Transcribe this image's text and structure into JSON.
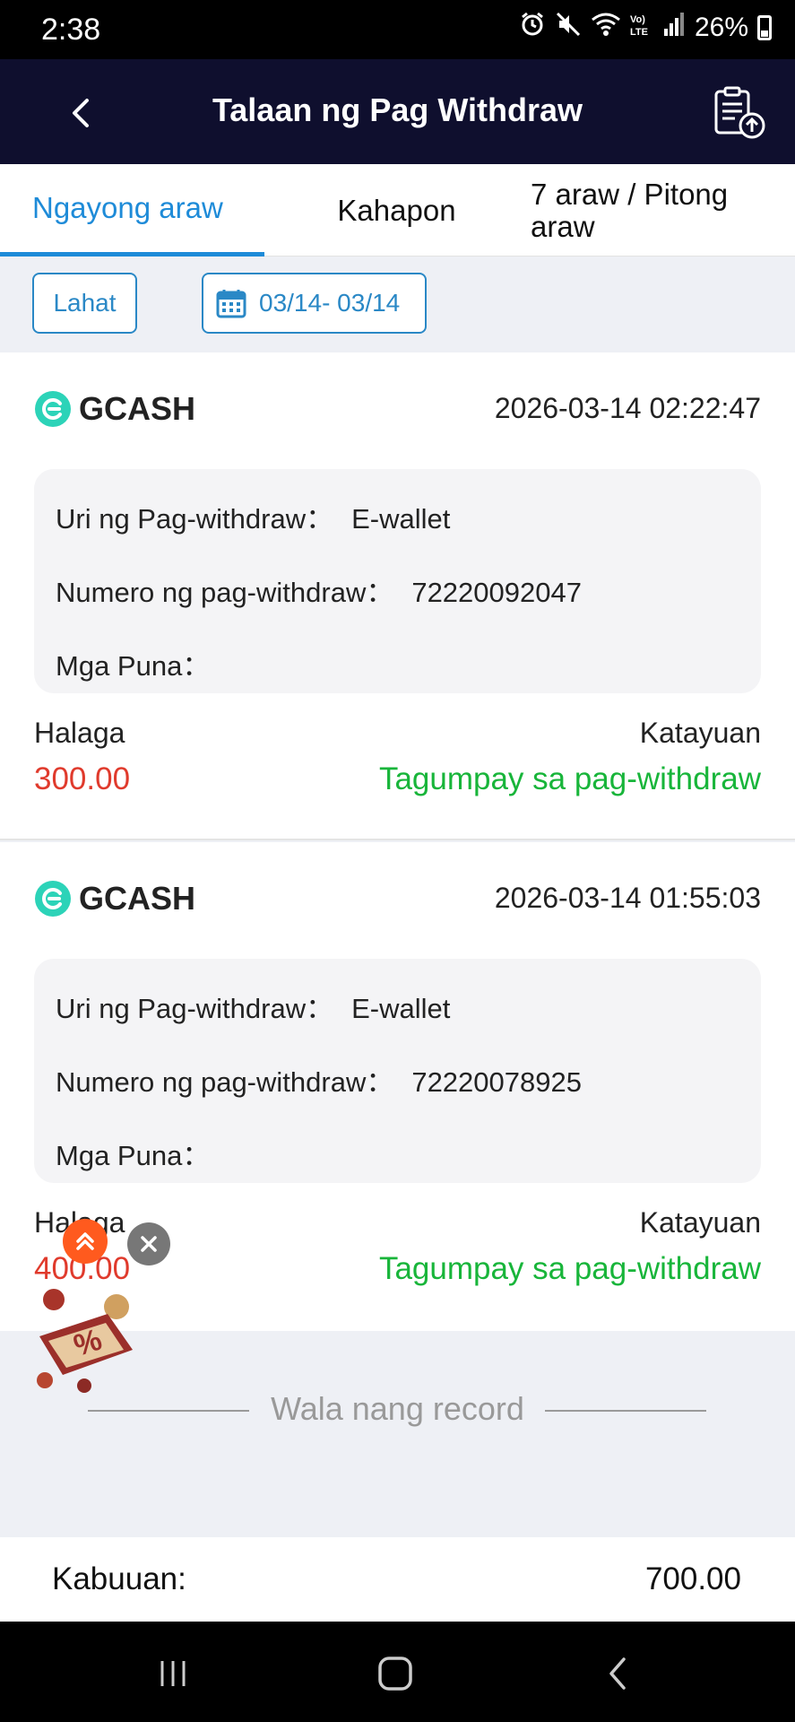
{
  "status_bar": {
    "time": "2:38",
    "battery": "26%",
    "icons": [
      "alarm-icon",
      "mute-icon",
      "wifi-icon",
      "volte-icon",
      "signal-icon",
      "battery-icon"
    ]
  },
  "header": {
    "title": "Talaan ng Pag Withdraw",
    "back_icon": "chevron-left-icon",
    "action_icon": "clipboard-upload-icon"
  },
  "tabs": [
    {
      "label": "Ngayong araw",
      "active": true
    },
    {
      "label": "Kahapon",
      "active": false
    },
    {
      "label": "7 araw / Pitong araw",
      "active": false
    }
  ],
  "filters": {
    "all_label": "Lahat",
    "date_range": "03/14- 03/14",
    "date_icon": "calendar-icon"
  },
  "records": [
    {
      "provider": "GCASH",
      "datetime": "2026-03-14 02:22:47",
      "type_label": "Uri ng Pag-withdraw：",
      "type_value": "E-wallet",
      "number_label": "Numero ng pag-withdraw：",
      "number_value": "72220092047",
      "remarks_label": "Mga Puna：",
      "remarks_value": "",
      "amount_label": "Halaga",
      "amount_value": "300.00",
      "status_label": "Katayuan",
      "status_value": "Tagumpay sa pag-withdraw"
    },
    {
      "provider": "GCASH",
      "datetime": "2026-03-14 01:55:03",
      "type_label": "Uri ng Pag-withdraw：",
      "type_value": "E-wallet",
      "number_label": "Numero ng pag-withdraw：",
      "number_value": "72220078925",
      "remarks_label": "Mga Puna：",
      "remarks_value": "",
      "amount_label": "Halaga",
      "amount_value": "400.00",
      "status_label": "Katayuan",
      "status_value": "Tagumpay sa pag-withdraw"
    }
  ],
  "end_text": "Wala nang record",
  "total": {
    "label": "Kabuuan:",
    "value": "700.00"
  },
  "colors": {
    "header_bg": "#0f0f2e",
    "accent": "#1e8bd8",
    "amount": "#e03a2c",
    "success": "#18b53a"
  }
}
